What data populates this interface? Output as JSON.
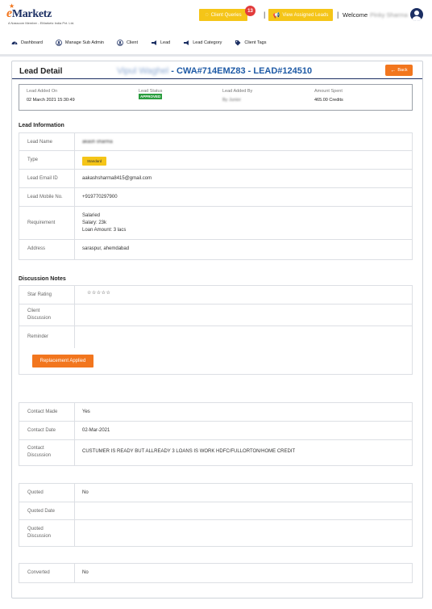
{
  "brand": {
    "logo_text": "Marketz",
    "logo_e": "e",
    "tagline": "A Nasscom Member - EMarketz India Pvt. Ltd."
  },
  "header": {
    "client_queries_label": "Client Queries",
    "client_queries_count": "13",
    "view_assigned_label": "View Assigned Leads",
    "separator": "|",
    "welcome_label": "Welcome",
    "user_name": "Pinky Sharma"
  },
  "nav": {
    "items": [
      {
        "label": "Dashboard",
        "icon": "dashboard-icon"
      },
      {
        "label": "Manage Sub Admin",
        "icon": "user-circle-icon"
      },
      {
        "label": "Client",
        "icon": "user-circle-icon"
      },
      {
        "label": "Lead",
        "icon": "megaphone-icon"
      },
      {
        "label": "Lead Category",
        "icon": "megaphone-icon"
      },
      {
        "label": "Client Tags",
        "icon": "tag-icon"
      }
    ]
  },
  "lead_detail": {
    "title": "Lead Detail",
    "client_name": "Vipul Waghel",
    "client_code": " - CWA#714EMZ83 - ",
    "lead_code": "LEAD#124510",
    "back_label": "Back",
    "summary": {
      "added_on_label": "Lead Added On",
      "added_on_value": "02 March 2021  15:30:49",
      "status_label": "Lead Status",
      "status_value": "APPROVED",
      "added_by_label": "Lead Added By",
      "added_by_value": "By Junior",
      "amount_label": "Amount Spent",
      "amount_value": "465.00 Credits"
    }
  },
  "lead_information": {
    "heading": "Lead Information",
    "name_label": "Lead Name",
    "name_value": "akash sharma",
    "type_label": "Type",
    "type_value": "Standard",
    "email_label": "Lead Email ID",
    "email_value": "aakashsharma8415@gmail.com",
    "mobile_label": "Lead Mobile No.",
    "mobile_value": "+919770297900",
    "requirement_label": "Requirement",
    "requirement_lines": [
      "Salaried",
      "Salary: 23k",
      "Loan Amount: 3 lacs"
    ],
    "address_label": "Address",
    "address_value": "saraspur, ahemdabad"
  },
  "discussion": {
    "heading": "Discussion Notes",
    "star_label": "Star Rating",
    "star_rating": 0,
    "star_max": 5,
    "stars_text": "☆☆☆☆☆",
    "client_discussion_label_1": "Client",
    "client_discussion_label_2": "Discussion",
    "reminder_label": "Reminder",
    "replacement_button": "Replacement Applied"
  },
  "contact": {
    "made_label": "Contact Made",
    "made_value": "Yes",
    "date_label": "Contact Date",
    "date_value": "02-Mar-2021",
    "discussion_label_1": "Contact",
    "discussion_label_2": "Discussion",
    "discussion_value": "CUSTUMER IS READY BUT ALLREADY  3 LOANS IS WORK HDFC/FULLORTON/HOME CREDIT"
  },
  "quoted": {
    "quoted_label": "Quoted",
    "quoted_value": "No",
    "date_label": "Quoted Date",
    "discussion_label_1": "Quoted",
    "discussion_label_2": "Discussion"
  },
  "converted": {
    "label": "Converted",
    "value": "No"
  },
  "colors": {
    "brand_navy": "#1c2f63",
    "accent_orange": "#f2761e",
    "accent_yellow": "#f5c518",
    "approved_green": "#2a9d3f",
    "link_blue": "#1e5aa6"
  }
}
